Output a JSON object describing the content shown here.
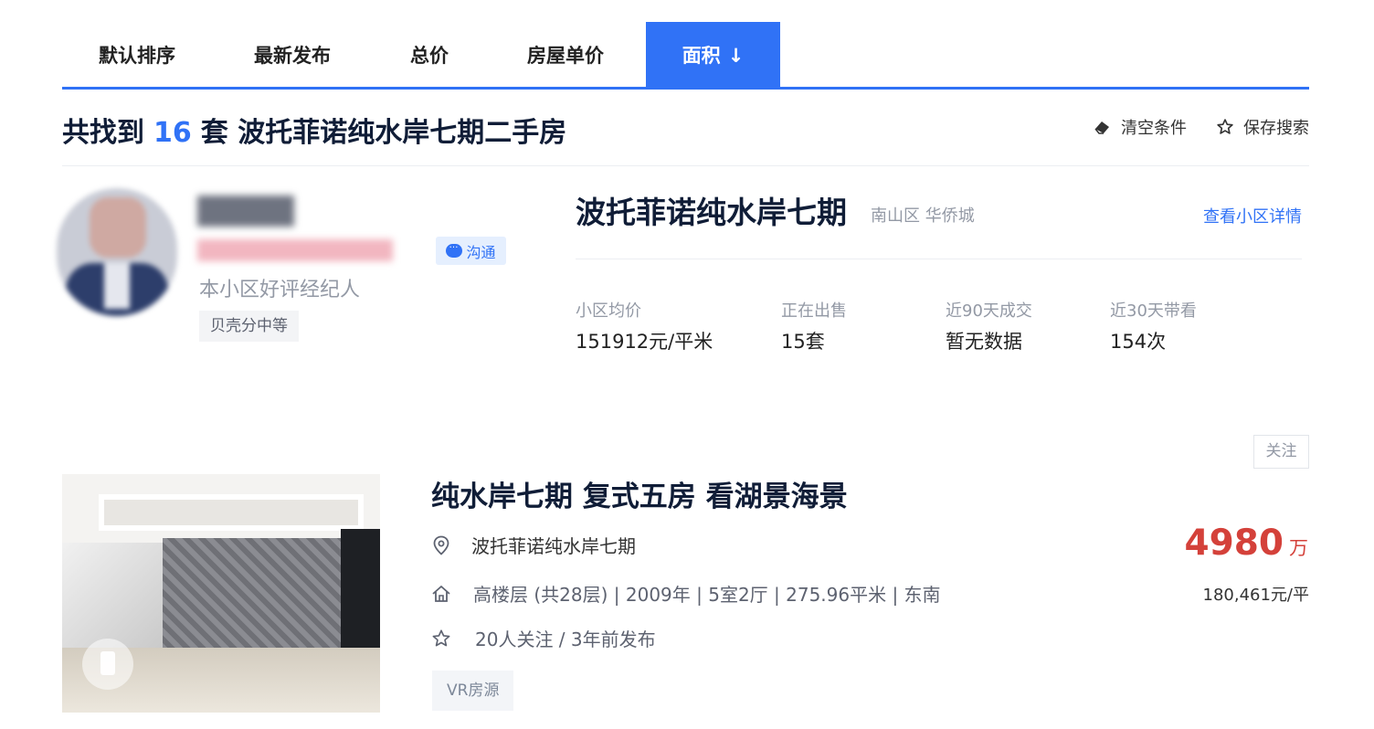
{
  "sort_tabs": [
    {
      "label": "默认排序",
      "active": false
    },
    {
      "label": "最新发布",
      "active": false
    },
    {
      "label": "总价",
      "active": false
    },
    {
      "label": "房屋单价",
      "active": false
    },
    {
      "label": "面积",
      "active": true,
      "arrow": "↓"
    }
  ],
  "results": {
    "prefix": "共找到",
    "count": "16",
    "suffix": "套 波托菲诺纯水岸七期二手房"
  },
  "header_actions": {
    "clear_label": "清空条件",
    "save_label": "保存搜索"
  },
  "agent": {
    "chat_label": "沟通",
    "description": "本小区好评经纪人",
    "tag": "贝壳分中等"
  },
  "community": {
    "name": "波托菲诺纯水岸七期",
    "location": "南山区 华侨城",
    "detail_link": "查看小区详情",
    "stats": [
      {
        "label": "小区均价",
        "value": "151912元/平米"
      },
      {
        "label": "正在出售",
        "value": "15套"
      },
      {
        "label": "近90天成交",
        "value": "暂无数据"
      },
      {
        "label": "近30天带看",
        "value": "154次"
      }
    ]
  },
  "listing": {
    "follow_label": "关注",
    "title": "纯水岸七期 复式五房 看湖景海景",
    "community": "波托菲诺纯水岸七期",
    "house_info": "高楼层 (共28层) | 2009年 | 5室2厅 | 275.96平米 | 东南",
    "follow_info": "20人关注 / 3年前发布",
    "tag": "VR房源",
    "total_price": "4980",
    "total_price_unit": "万",
    "unit_price": "180,461元/平"
  },
  "colors": {
    "accent": "#3072f6",
    "price": "#d4413a",
    "title": "#101d37"
  },
  "icons": [
    "eraser-icon",
    "star-icon",
    "chat-icon",
    "location-pin-icon",
    "house-icon",
    "star-outline-icon",
    "vr-icon"
  ]
}
